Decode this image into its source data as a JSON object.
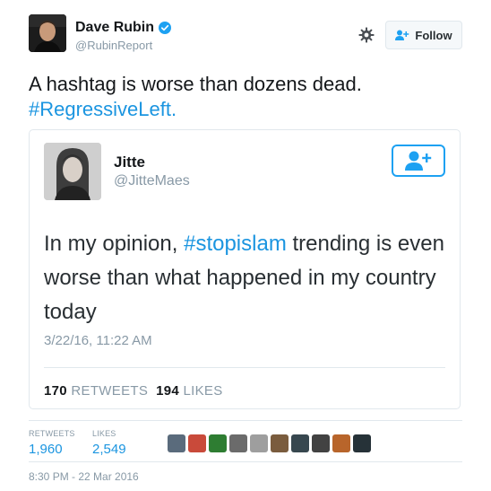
{
  "author": {
    "display_name": "Dave Rubin",
    "handle": "@RubinReport",
    "verified_icon": "verified-badge-icon"
  },
  "actions": {
    "follow_label": "Follow",
    "settings_icon": "gear-icon"
  },
  "tweet": {
    "text_plain": "A hashtag is worse than dozens dead.",
    "hashtag": "#RegressiveLeft."
  },
  "quoted": {
    "display_name": "Jitte",
    "handle": "@JitteMaes",
    "text_before": "In my opinion, ",
    "hashtag": "#stopislam",
    "text_after": " trending is even worse than what happened in my country today",
    "timestamp": "3/22/16, 11:22 AM",
    "retweets_count": "170",
    "retweets_label": "RETWEETS",
    "likes_count": "194",
    "likes_label": "LIKES"
  },
  "stats": {
    "retweets_label": "RETWEETS",
    "retweets_value": "1,960",
    "likes_label": "LIKES",
    "likes_value": "2,549"
  },
  "likers": [
    {
      "color": "#5a6b7c"
    },
    {
      "color": "#c94a3a"
    },
    {
      "color": "#2e7d32"
    },
    {
      "color": "#6b6b6b"
    },
    {
      "color": "#9e9e9e"
    },
    {
      "color": "#7a5c3e"
    },
    {
      "color": "#37474f"
    },
    {
      "color": "#424242"
    },
    {
      "color": "#b8652b"
    },
    {
      "color": "#263238"
    }
  ],
  "footer": {
    "timestamp": "8:30 PM - 22 Mar 2016"
  },
  "colors": {
    "link": "#1b95e0",
    "follow_accent": "#1da1f2",
    "muted": "#8899a6",
    "verified": "#1da1f2"
  }
}
